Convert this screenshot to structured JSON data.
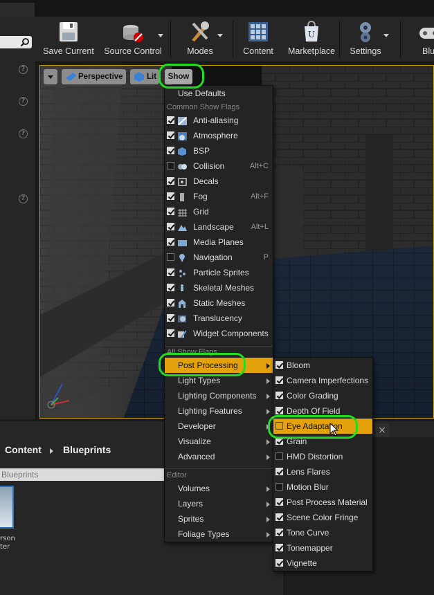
{
  "toolbar": {
    "save": "Save Current",
    "source": "Source Control",
    "modes": "Modes",
    "content": "Content",
    "marketplace": "Marketplace",
    "settings": "Settings",
    "blueprints": "Blueprints"
  },
  "viewport": {
    "perspective": "Perspective",
    "lit": "Lit",
    "show": "Show"
  },
  "show_menu": {
    "use_defaults": "Use Defaults",
    "common_header": "Common Show Flags",
    "common": [
      {
        "label": "Anti-aliasing",
        "checked": true,
        "shortcut": "",
        "icon": "anti-aliasing-icon"
      },
      {
        "label": "Atmosphere",
        "checked": true,
        "shortcut": "",
        "icon": "atmosphere-icon"
      },
      {
        "label": "BSP",
        "checked": true,
        "shortcut": "",
        "icon": "bsp-icon"
      },
      {
        "label": "Collision",
        "checked": false,
        "shortcut": "Alt+C",
        "icon": "collision-icon"
      },
      {
        "label": "Decals",
        "checked": true,
        "shortcut": "",
        "icon": "decals-icon"
      },
      {
        "label": "Fog",
        "checked": true,
        "shortcut": "Alt+F",
        "icon": "fog-icon"
      },
      {
        "label": "Grid",
        "checked": true,
        "shortcut": "",
        "icon": "grid-icon"
      },
      {
        "label": "Landscape",
        "checked": true,
        "shortcut": "Alt+L",
        "icon": "landscape-icon"
      },
      {
        "label": "Media Planes",
        "checked": true,
        "shortcut": "",
        "icon": "media-planes-icon"
      },
      {
        "label": "Navigation",
        "checked": false,
        "shortcut": "P",
        "icon": "navigation-icon"
      },
      {
        "label": "Particle Sprites",
        "checked": true,
        "shortcut": "",
        "icon": "particle-sprites-icon"
      },
      {
        "label": "Skeletal Meshes",
        "checked": true,
        "shortcut": "",
        "icon": "skeletal-meshes-icon"
      },
      {
        "label": "Static Meshes",
        "checked": true,
        "shortcut": "",
        "icon": "static-meshes-icon"
      },
      {
        "label": "Translucency",
        "checked": true,
        "shortcut": "",
        "icon": "translucency-icon"
      },
      {
        "label": "Widget Components",
        "checked": true,
        "shortcut": "",
        "icon": "widget-components-icon"
      }
    ],
    "all_header": "All Show Flags",
    "all": [
      "Post Processing",
      "Light Types",
      "Lighting Components",
      "Lighting Features",
      "Developer",
      "Visualize",
      "Advanced"
    ],
    "editor_header": "Editor",
    "editor": [
      "Volumes",
      "Layers",
      "Sprites",
      "Foliage Types"
    ]
  },
  "post_menu": [
    {
      "label": "Bloom",
      "checked": true
    },
    {
      "label": "Camera Imperfections",
      "checked": true
    },
    {
      "label": "Color Grading",
      "checked": true
    },
    {
      "label": "Depth Of Field",
      "checked": true
    },
    {
      "label": "Eye Adaptation",
      "checked": false
    },
    {
      "label": "Grain",
      "checked": true
    },
    {
      "label": "HMD Distortion",
      "checked": false
    },
    {
      "label": "Lens Flares",
      "checked": true
    },
    {
      "label": "Motion Blur",
      "checked": false
    },
    {
      "label": "Post Process Material",
      "checked": true
    },
    {
      "label": "Scene Color Fringe",
      "checked": true
    },
    {
      "label": "Tone Curve",
      "checked": true
    },
    {
      "label": "Tonemapper",
      "checked": true
    },
    {
      "label": "Vignette",
      "checked": true
    }
  ],
  "content_browser": {
    "crumb1": "Content",
    "crumb2": "Blueprints",
    "filter": "Blueprints",
    "asset_label": "rson\nter"
  },
  "colors": {
    "highlight": "#e3a20c",
    "ring": "#21dd21",
    "viewport_border": "#c8a000"
  }
}
